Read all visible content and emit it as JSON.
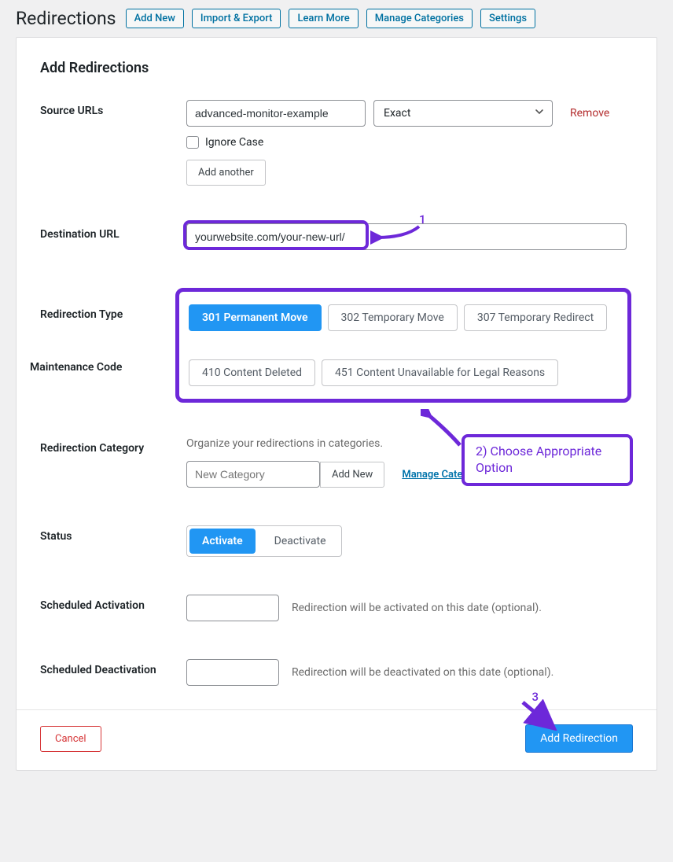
{
  "header": {
    "title": "Redirections",
    "buttons": [
      "Add New",
      "Import & Export",
      "Learn More",
      "Manage Categories",
      "Settings"
    ]
  },
  "panel": {
    "title": "Add Redirections"
  },
  "source": {
    "label": "Source URLs",
    "value": "advanced-monitor-example",
    "match_selected": "Exact",
    "remove": "Remove",
    "ignore_case": "Ignore Case",
    "add_another": "Add another"
  },
  "destination": {
    "label": "Destination URL",
    "value": "yourwebsite.com/your-new-url/"
  },
  "redirection_type": {
    "label": "Redirection Type",
    "options": [
      "301 Permanent Move",
      "302 Temporary Move",
      "307 Temporary Redirect"
    ],
    "active_index": 0
  },
  "maintenance": {
    "label": "Maintenance Code",
    "options": [
      "410 Content Deleted",
      "451 Content Unavailable for Legal Reasons"
    ]
  },
  "category": {
    "label": "Redirection Category",
    "help": "Organize your redirections in categories.",
    "placeholder": "New Category",
    "add_new": "Add New",
    "manage": "Manage Categories"
  },
  "status": {
    "label": "Status",
    "options": [
      "Activate",
      "Deactivate"
    ],
    "active_index": 0
  },
  "scheduled_activation": {
    "label": "Scheduled Activation",
    "hint": "Redirection will be activated on this date (optional)."
  },
  "scheduled_deactivation": {
    "label": "Scheduled Deactivation",
    "hint": "Redirection will be deactivated on this date (optional)."
  },
  "footer": {
    "cancel": "Cancel",
    "submit": "Add Redirection"
  },
  "annotations": {
    "num1": "1",
    "callout": "2) Choose Appropriate Option",
    "num3": "3"
  }
}
